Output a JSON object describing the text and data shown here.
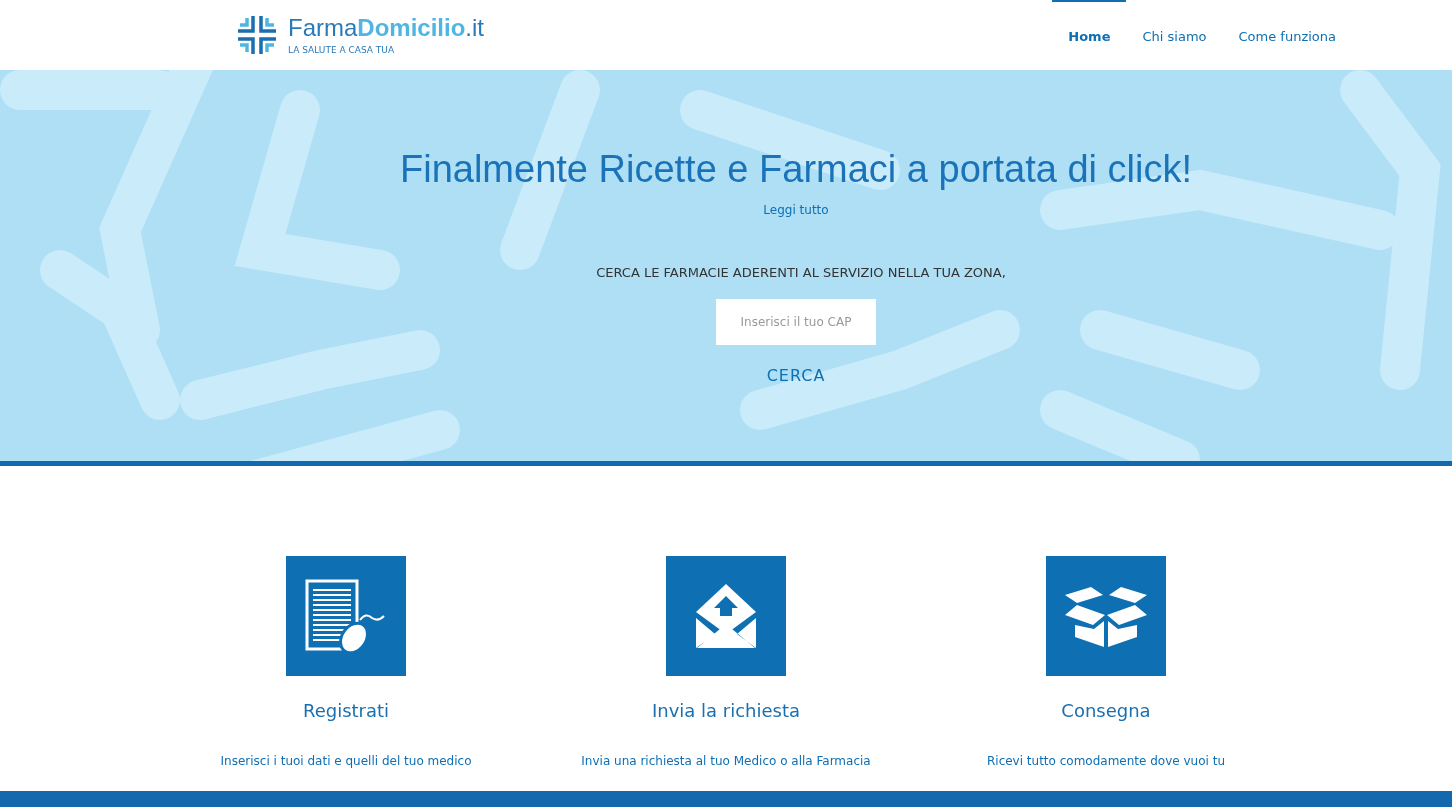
{
  "header": {
    "logo": {
      "name": "Farma**Domicilio**.it",
      "tagline": "LA SALUTE A CASA TUA"
    },
    "nav": [
      {
        "label": "Home",
        "selected": true
      },
      {
        "label": "Chi siamo",
        "selected": false
      },
      {
        "label": "Come funziona",
        "selected": false
      }
    ]
  },
  "hero": {
    "title": "Finalmente Ricette e Farmaci a portata di click!",
    "link": "Leggi tutto",
    "prompt": "CERCA LE FARMACIE ADERENTI AL SERVIZIO NELLA TUA ZONA,",
    "search": {
      "placeholder": "Inserisci il tuo CAP"
    },
    "button": "CERCA"
  },
  "features": [
    {
      "kind": "document",
      "title": "Registrati",
      "text": "Inserisci i tuoi dati e quelli del tuo medico"
    },
    {
      "kind": "envelope",
      "title": "Invia la richiesta",
      "text": "Invia una richiesta al tuo Medico o alla Farmacia"
    },
    {
      "kind": "box",
      "title": "Consegna",
      "text": "Ricevi tutto comodamente dove vuoi tu"
    }
  ]
}
